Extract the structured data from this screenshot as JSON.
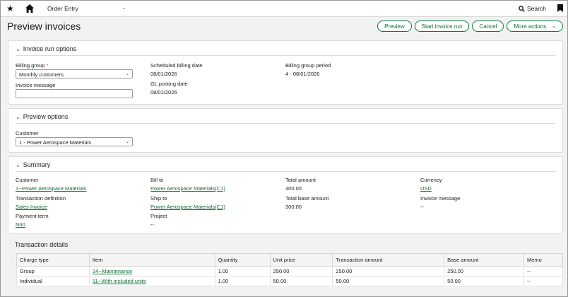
{
  "topbar": {
    "module": "Order Entry",
    "search_label": "Search"
  },
  "page": {
    "title": "Preview invoices"
  },
  "actions": {
    "preview": "Preview",
    "start_invoice_run": "Start invoice run",
    "cancel": "Cancel",
    "more_actions": "More actions"
  },
  "invoice_run_options": {
    "heading": "Invoice run options",
    "billing_group_label": "Billing group",
    "billing_group_value": "Monthly customers",
    "invoice_message_label": "Invoice message",
    "invoice_message_value": "",
    "scheduled_billing_date_label": "Scheduled billing date",
    "scheduled_billing_date_value": "08/01/2026",
    "gl_posting_date_label": "GL posting date",
    "gl_posting_date_value": "08/01/2026",
    "billing_group_period_label": "Billing group period",
    "billing_group_period_value": "4 - 08/01/2026"
  },
  "preview_options": {
    "heading": "Preview options",
    "customer_label": "Customer",
    "customer_value": "1 - Power Aerospace Materials"
  },
  "summary": {
    "heading": "Summary",
    "customer_label": "Customer",
    "customer_value": "1--Power Aerospace Materials",
    "transaction_definition_label": "Transaction definition",
    "transaction_definition_value": "Sales Invoice",
    "payment_term_label": "Payment term",
    "payment_term_value": "N30",
    "bill_to_label": "Bill to",
    "bill_to_value": "Power Aerospace Materials(C1)",
    "ship_to_label": "Ship to",
    "ship_to_value": "Power Aerospace Materials(C1)",
    "project_label": "Project",
    "project_value": "--",
    "total_amount_label": "Total amount",
    "total_amount_value": "300.00",
    "total_base_amount_label": "Total base amount",
    "total_base_amount_value": "300.00",
    "currency_label": "Currency",
    "currency_value": "USD",
    "invoice_message_label": "Invoice message",
    "invoice_message_value": "--"
  },
  "transaction_details": {
    "heading": "Transaction details",
    "columns": [
      "Charge type",
      "Item",
      "Quantity",
      "Unit price",
      "Transaction amount",
      "Base amount",
      "Memo"
    ],
    "rows": [
      [
        "Group",
        "14--Maintenance",
        "1.00",
        "250.00",
        "250.00",
        "250.00",
        "--"
      ],
      [
        "Individual",
        "11--With included units",
        "1.00",
        "50.00",
        "50.00",
        "50.00",
        "--"
      ]
    ]
  },
  "colors": {
    "accent": "#0f6b35",
    "required": "#c0392b"
  },
  "icons": [
    "star-icon",
    "home-icon",
    "chevron-down-icon",
    "search-icon",
    "bookmark-icon",
    "caret-down-icon"
  ]
}
